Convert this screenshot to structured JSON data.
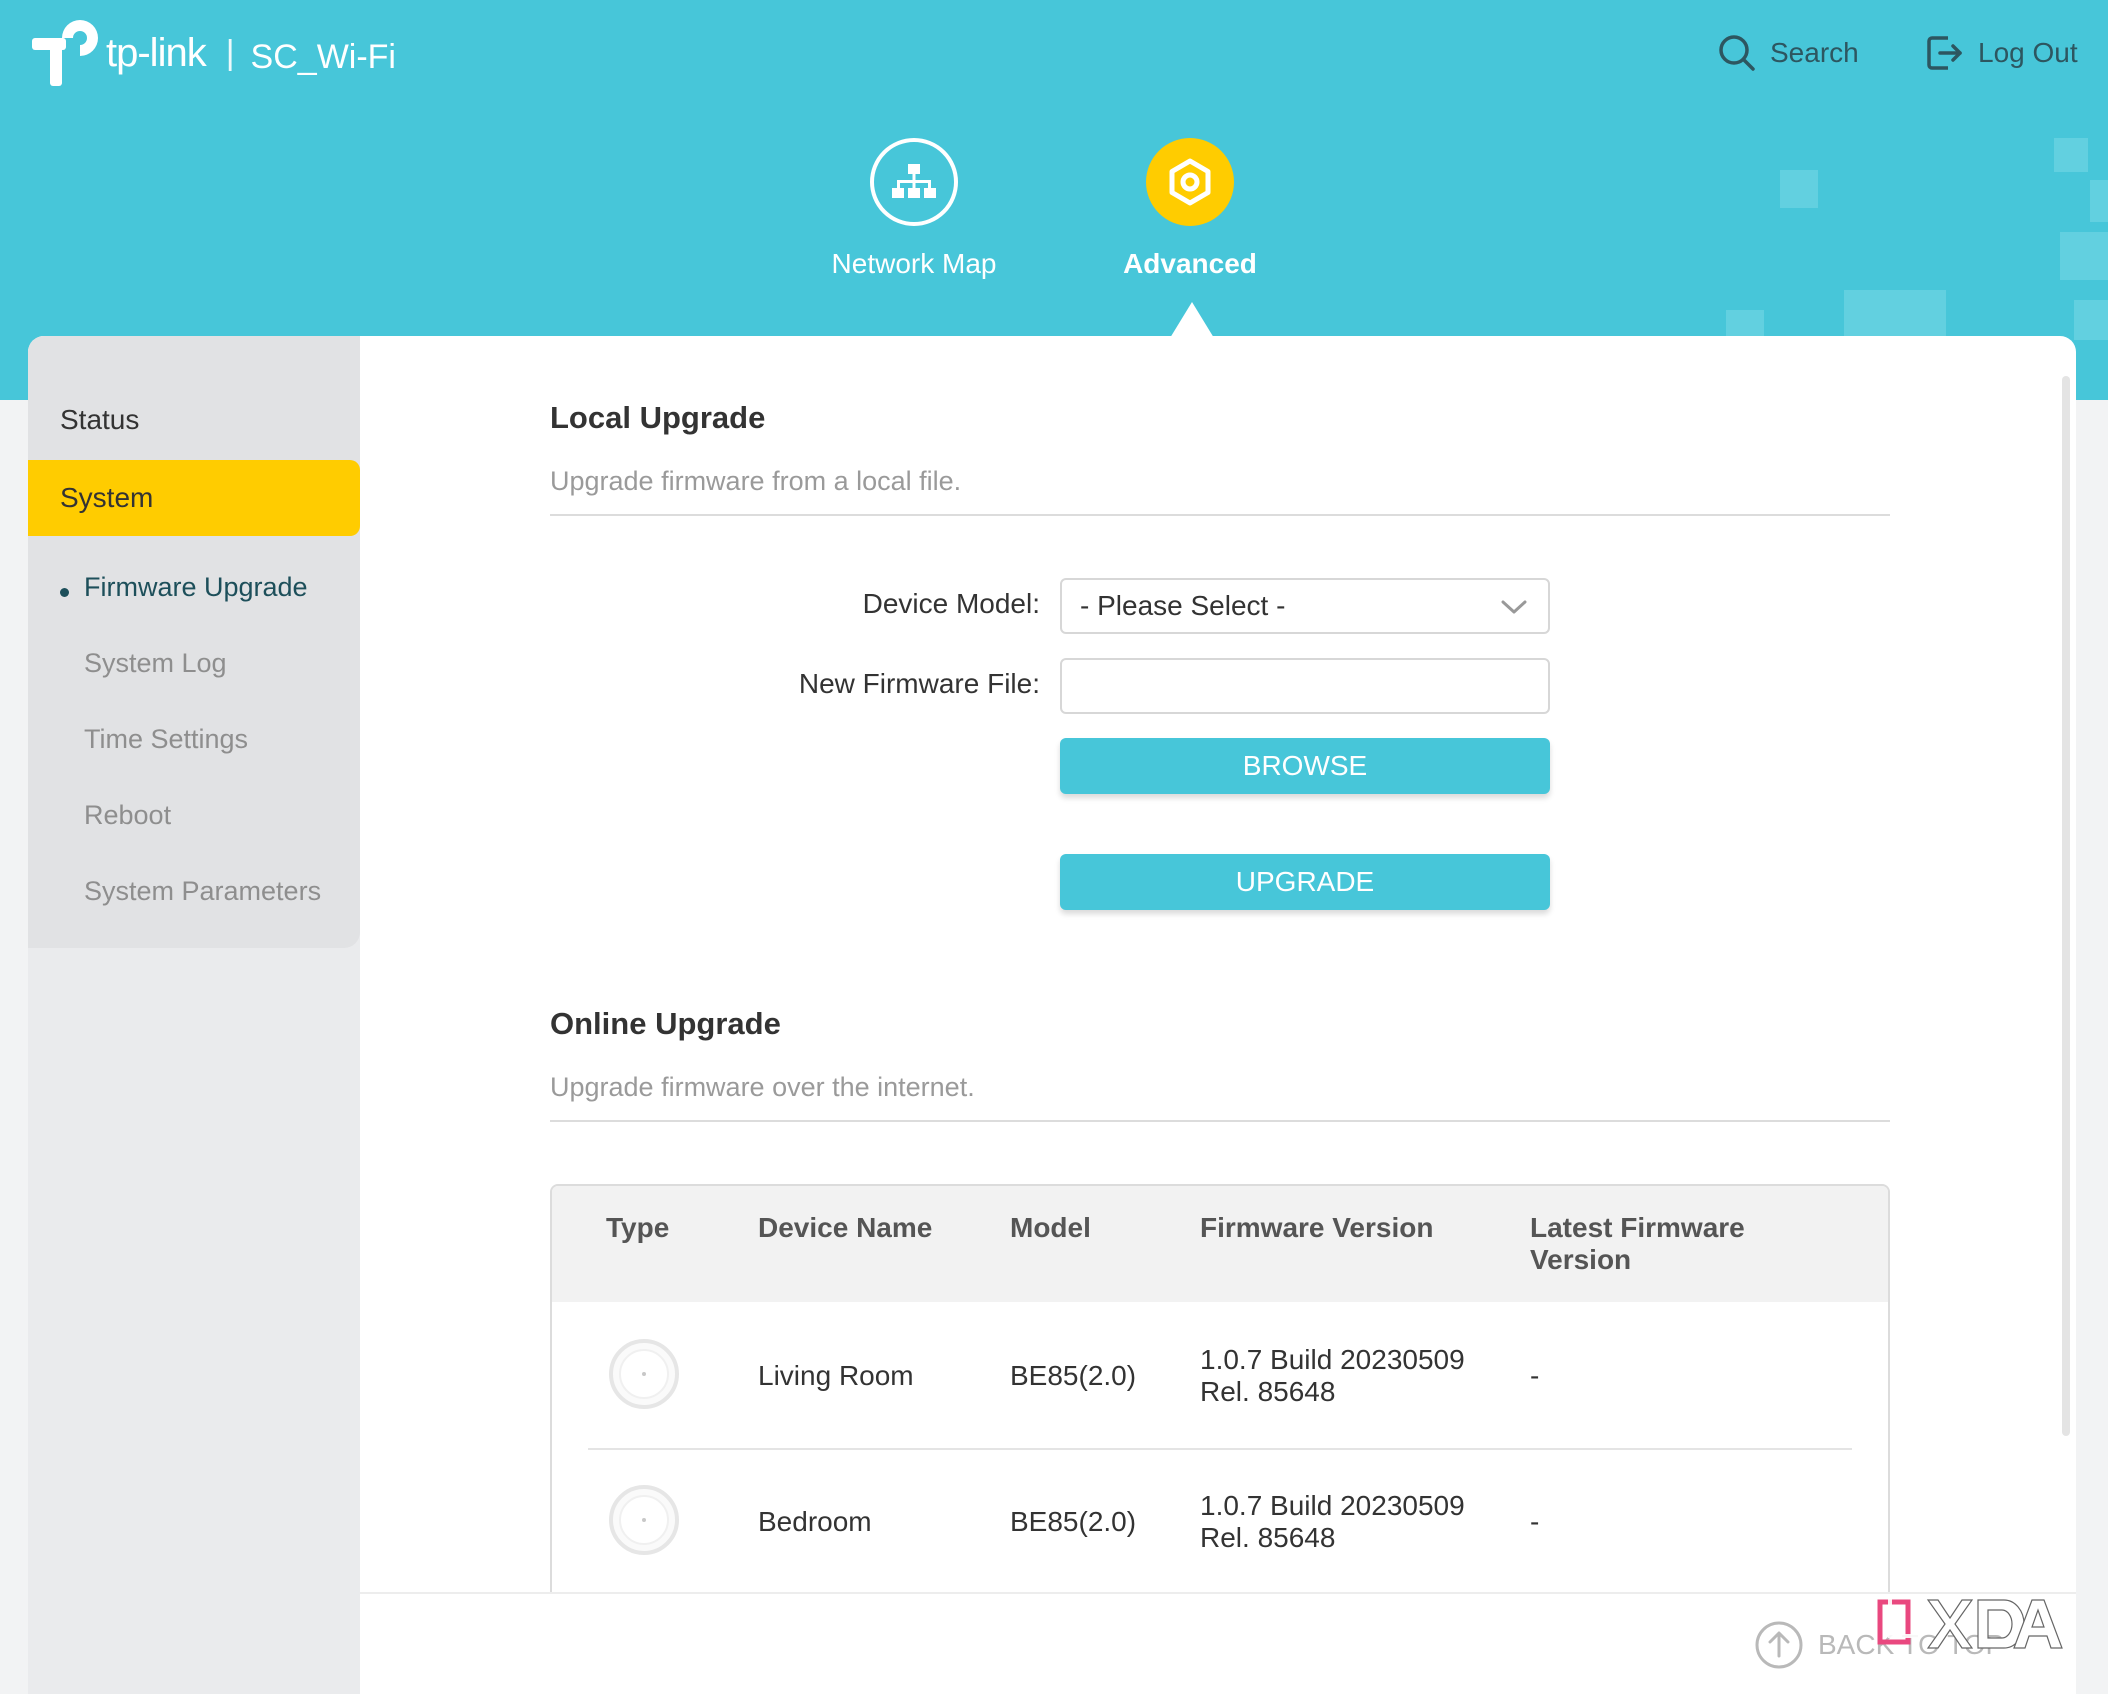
{
  "header": {
    "brand": "tp-link",
    "ssid": "SC_Wi-Fi",
    "search_label": "Search",
    "logout_label": "Log Out",
    "nav": [
      {
        "label": "Network Map",
        "icon": "network-map-icon"
      },
      {
        "label": "Advanced",
        "icon": "advanced-gear-icon",
        "active": true
      }
    ]
  },
  "sidebar": {
    "status_label": "Status",
    "system_label": "System",
    "items": [
      {
        "label": "Firmware Upgrade",
        "active": true
      },
      {
        "label": "System Log"
      },
      {
        "label": "Time Settings"
      },
      {
        "label": "Reboot"
      },
      {
        "label": "System Parameters"
      }
    ]
  },
  "local_upgrade": {
    "title": "Local Upgrade",
    "description": "Upgrade firmware from a local file.",
    "device_model_label": "Device Model:",
    "device_model_value": "- Please Select -",
    "firmware_file_label": "New Firmware File:",
    "firmware_file_value": "",
    "browse_label": "BROWSE",
    "upgrade_label": "UPGRADE"
  },
  "online_upgrade": {
    "title": "Online Upgrade",
    "description": "Upgrade firmware over the internet.",
    "columns": [
      "Type",
      "Device Name",
      "Model",
      "Firmware Version",
      "Latest Firmware Version"
    ],
    "rows": [
      {
        "name": "Living Room",
        "model": "BE85(2.0)",
        "firmware_line1": "1.0.7 Build 20230509",
        "firmware_line2": "Rel. 85648",
        "latest": "-"
      },
      {
        "name": "Bedroom",
        "model": "BE85(2.0)",
        "firmware_line1": "1.0.7 Build 20230509",
        "firmware_line2": "Rel. 85648",
        "latest": "-"
      }
    ]
  },
  "footer": {
    "back_to_top_label": "BACK TO TOP"
  },
  "watermark": "XDA",
  "colors": {
    "accent": "#47c6d9",
    "highlight": "#ffcc00"
  }
}
